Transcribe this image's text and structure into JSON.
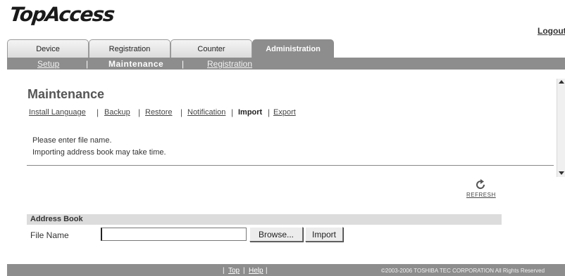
{
  "header": {
    "logo": "TopAccess",
    "logout": "Logout"
  },
  "tabs": [
    {
      "label": "Device",
      "active": false
    },
    {
      "label": "Registration",
      "active": false
    },
    {
      "label": "Counter",
      "active": false
    },
    {
      "label": "Administration",
      "active": true
    }
  ],
  "subnav": {
    "setup": "Setup",
    "maintenance": "Maintenance",
    "registration": "Registration",
    "separator": "|"
  },
  "page": {
    "title": "Maintenance",
    "menu": [
      "Install Language",
      "Backup",
      "Restore",
      "Notification",
      "Import",
      "Export"
    ],
    "menu_current": "Import",
    "messages": [
      "Please enter file name.",
      "Importing address book may take time."
    ]
  },
  "refresh": {
    "label": "REFRESH",
    "icon": "refresh-icon"
  },
  "address_book": {
    "title": "Address Book",
    "file_name_label": "File Name",
    "file_value": "",
    "browse_label": "Browse...",
    "import_label": "Import"
  },
  "footer": {
    "top": "Top",
    "help": "Help",
    "copyright": "©2003-2006 TOSHIBA TEC CORPORATION All Rights Reserved"
  },
  "colors": {
    "nav_gray": "#8d8d8d",
    "section_bar": "#dcdcdc"
  }
}
